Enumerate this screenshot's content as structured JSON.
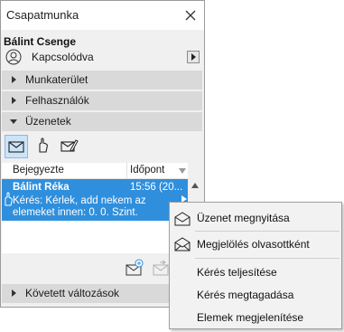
{
  "window": {
    "title": "Csapatmunka"
  },
  "user": {
    "name": "Bálint Csenge",
    "status": "Kapcsolódva"
  },
  "sections": {
    "workspace": "Munkaterület",
    "users": "Felhasználók",
    "messages": "Üzenetek",
    "tracked": "Követett változások"
  },
  "message_list": {
    "columns": {
      "subject": "Bejegyezte",
      "time": "Időpont"
    },
    "items": [
      {
        "sender": "Bálint Réka",
        "time": "15:56 (20...",
        "body": "Kérés: Kérlek, add nekem az elemeket innen: 0. 0. Szint.",
        "selected": true
      }
    ]
  },
  "context_menu": {
    "items": [
      {
        "label": "Üzenet megnyitása",
        "icon": "open-envelope-icon"
      },
      {
        "label": "Megjelölés olvasottként",
        "icon": "read-envelope-icon"
      },
      {
        "label": "Kérés teljesítése"
      },
      {
        "label": "Kérés megtagadása"
      },
      {
        "label": "Elemek megjelenítése"
      }
    ]
  },
  "colors": {
    "selection": "#2f8fdd",
    "section_header": "#d9d9d9",
    "panel_bg": "#f0f0f0"
  }
}
